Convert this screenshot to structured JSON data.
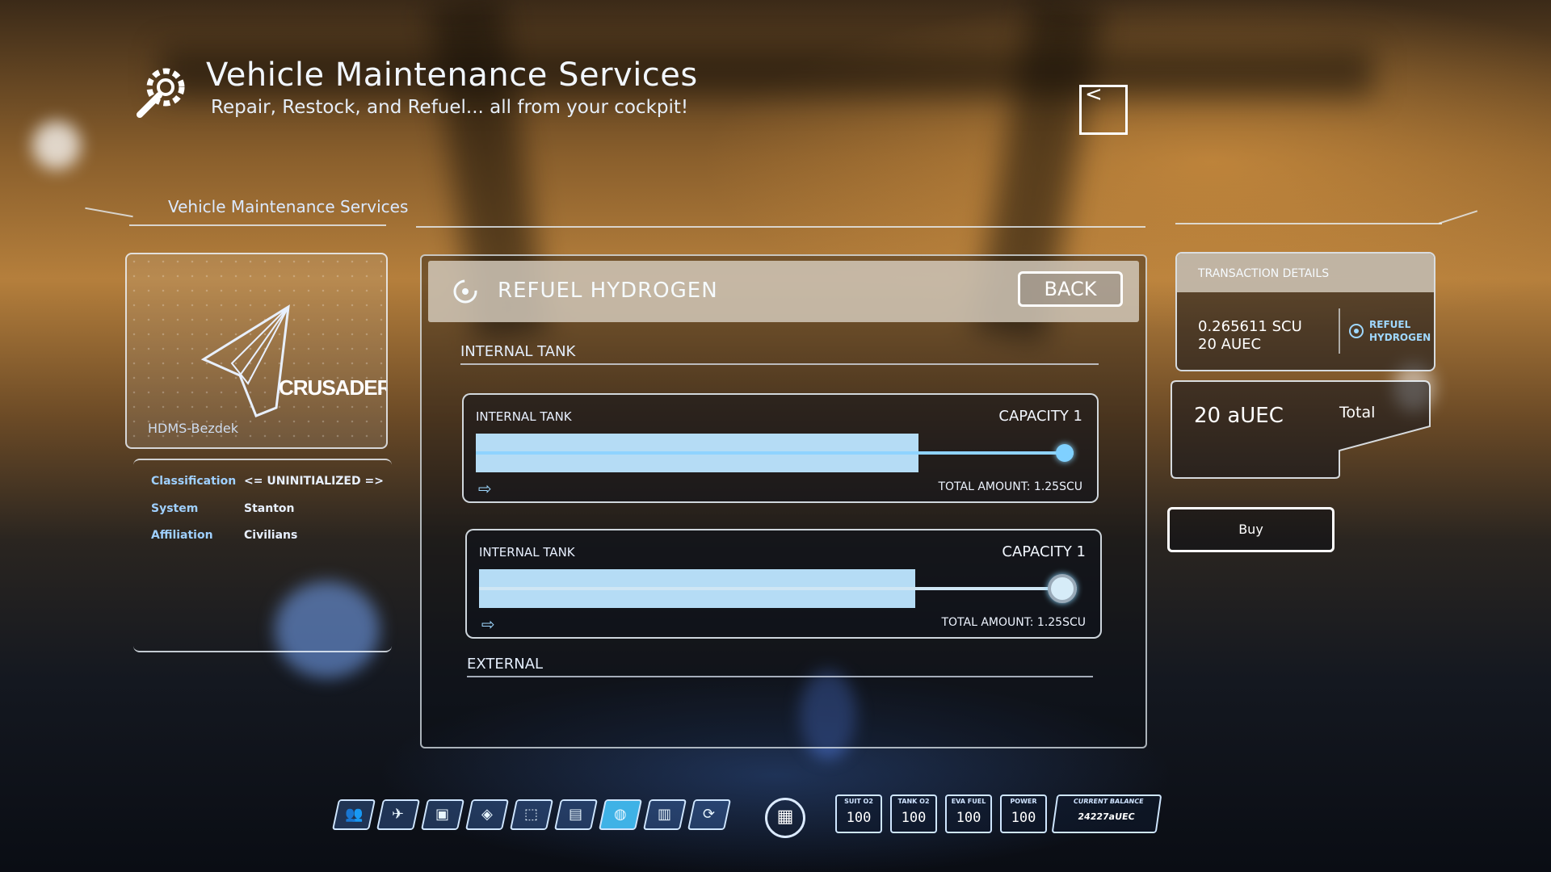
{
  "header": {
    "title": "Vehicle Maintenance Services",
    "subtitle": "Repair, Restock, and Refuel... all from your cockpit!",
    "close_label": "<"
  },
  "section_label": "Vehicle Maintenance Services",
  "ship": {
    "name": "HDMS-Bezdek",
    "brand": "CRUSADER",
    "info": [
      {
        "key": "Classification",
        "value": "<= UNINITIALIZED =>"
      },
      {
        "key": "System",
        "value": "Stanton"
      },
      {
        "key": "Affiliation",
        "value": "Civilians"
      }
    ]
  },
  "main": {
    "title": "REFUEL HYDROGEN",
    "back_label": "BACK",
    "group_internal": "INTERNAL TANK",
    "group_external": "EXTERNAL",
    "tanks": [
      {
        "name": "INTERNAL TANK",
        "capacity": "CAPACITY 1",
        "total": "TOTAL AMOUNT: 1.25SCU",
        "fill": 0.74,
        "arrow": "⇨"
      },
      {
        "name": "INTERNAL TANK",
        "capacity": "CAPACITY 1",
        "total": "TOTAL AMOUNT: 1.25SCU",
        "fill": 0.73,
        "arrow": "⇨"
      }
    ]
  },
  "transaction": {
    "heading": "TRANSACTION DETAILS",
    "amount_scu": "0.265611 SCU",
    "amount_auec": "20 AUEC",
    "action_line1": "REFUEL",
    "action_line2": "HYDROGEN",
    "total_value": "20 aUEC",
    "total_label": "Total",
    "buy_label": "Buy"
  },
  "toolbar": {
    "icons": [
      {
        "name": "contacts-icon",
        "glyph": "👥"
      },
      {
        "name": "ship-icon",
        "glyph": "✈"
      },
      {
        "name": "armor-icon",
        "glyph": "▣"
      },
      {
        "name": "shield-icon",
        "glyph": "◈"
      },
      {
        "name": "cargo-icon",
        "glyph": "⬚"
      },
      {
        "name": "journal-icon",
        "glyph": "▤"
      },
      {
        "name": "fuel-icon",
        "glyph": "◍"
      },
      {
        "name": "terminal-icon",
        "glyph": "▥"
      },
      {
        "name": "recycle-icon",
        "glyph": "⟳"
      }
    ],
    "active_index": 6,
    "mobiglas_glyph": "▦",
    "stats": [
      {
        "label": "SUIT O2",
        "value": "100"
      },
      {
        "label": "TANK O2",
        "value": "100"
      },
      {
        "label": "EVA FUEL",
        "value": "100"
      },
      {
        "label": "POWER",
        "value": "100"
      }
    ],
    "balance_label": "CURRENT BALANCE",
    "balance_value": "24227aUEC"
  },
  "colors": {
    "accent": "#3fb2e6",
    "bar_fill": "#b5dcf5",
    "label_blue": "#9fd0ff"
  }
}
